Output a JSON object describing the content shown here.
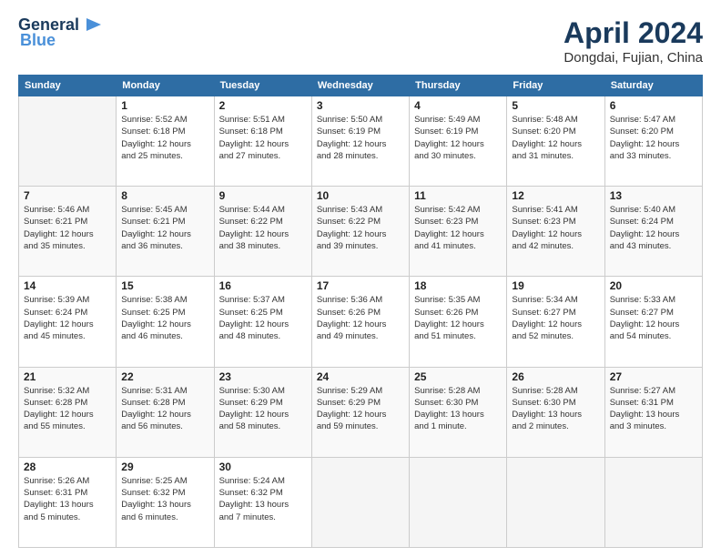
{
  "header": {
    "logo_line1": "General",
    "logo_line2": "Blue",
    "month": "April 2024",
    "location": "Dongdai, Fujian, China"
  },
  "weekdays": [
    "Sunday",
    "Monday",
    "Tuesday",
    "Wednesday",
    "Thursday",
    "Friday",
    "Saturday"
  ],
  "weeks": [
    [
      {
        "day": "",
        "empty": true
      },
      {
        "day": "1",
        "sunrise": "5:52 AM",
        "sunset": "6:18 PM",
        "daylight": "12 hours and 25 minutes."
      },
      {
        "day": "2",
        "sunrise": "5:51 AM",
        "sunset": "6:18 PM",
        "daylight": "12 hours and 27 minutes."
      },
      {
        "day": "3",
        "sunrise": "5:50 AM",
        "sunset": "6:19 PM",
        "daylight": "12 hours and 28 minutes."
      },
      {
        "day": "4",
        "sunrise": "5:49 AM",
        "sunset": "6:19 PM",
        "daylight": "12 hours and 30 minutes."
      },
      {
        "day": "5",
        "sunrise": "5:48 AM",
        "sunset": "6:20 PM",
        "daylight": "12 hours and 31 minutes."
      },
      {
        "day": "6",
        "sunrise": "5:47 AM",
        "sunset": "6:20 PM",
        "daylight": "12 hours and 33 minutes."
      }
    ],
    [
      {
        "day": "7",
        "sunrise": "5:46 AM",
        "sunset": "6:21 PM",
        "daylight": "12 hours and 35 minutes."
      },
      {
        "day": "8",
        "sunrise": "5:45 AM",
        "sunset": "6:21 PM",
        "daylight": "12 hours and 36 minutes."
      },
      {
        "day": "9",
        "sunrise": "5:44 AM",
        "sunset": "6:22 PM",
        "daylight": "12 hours and 38 minutes."
      },
      {
        "day": "10",
        "sunrise": "5:43 AM",
        "sunset": "6:22 PM",
        "daylight": "12 hours and 39 minutes."
      },
      {
        "day": "11",
        "sunrise": "5:42 AM",
        "sunset": "6:23 PM",
        "daylight": "12 hours and 41 minutes."
      },
      {
        "day": "12",
        "sunrise": "5:41 AM",
        "sunset": "6:23 PM",
        "daylight": "12 hours and 42 minutes."
      },
      {
        "day": "13",
        "sunrise": "5:40 AM",
        "sunset": "6:24 PM",
        "daylight": "12 hours and 43 minutes."
      }
    ],
    [
      {
        "day": "14",
        "sunrise": "5:39 AM",
        "sunset": "6:24 PM",
        "daylight": "12 hours and 45 minutes."
      },
      {
        "day": "15",
        "sunrise": "5:38 AM",
        "sunset": "6:25 PM",
        "daylight": "12 hours and 46 minutes."
      },
      {
        "day": "16",
        "sunrise": "5:37 AM",
        "sunset": "6:25 PM",
        "daylight": "12 hours and 48 minutes."
      },
      {
        "day": "17",
        "sunrise": "5:36 AM",
        "sunset": "6:26 PM",
        "daylight": "12 hours and 49 minutes."
      },
      {
        "day": "18",
        "sunrise": "5:35 AM",
        "sunset": "6:26 PM",
        "daylight": "12 hours and 51 minutes."
      },
      {
        "day": "19",
        "sunrise": "5:34 AM",
        "sunset": "6:27 PM",
        "daylight": "12 hours and 52 minutes."
      },
      {
        "day": "20",
        "sunrise": "5:33 AM",
        "sunset": "6:27 PM",
        "daylight": "12 hours and 54 minutes."
      }
    ],
    [
      {
        "day": "21",
        "sunrise": "5:32 AM",
        "sunset": "6:28 PM",
        "daylight": "12 hours and 55 minutes."
      },
      {
        "day": "22",
        "sunrise": "5:31 AM",
        "sunset": "6:28 PM",
        "daylight": "12 hours and 56 minutes."
      },
      {
        "day": "23",
        "sunrise": "5:30 AM",
        "sunset": "6:29 PM",
        "daylight": "12 hours and 58 minutes."
      },
      {
        "day": "24",
        "sunrise": "5:29 AM",
        "sunset": "6:29 PM",
        "daylight": "12 hours and 59 minutes."
      },
      {
        "day": "25",
        "sunrise": "5:28 AM",
        "sunset": "6:30 PM",
        "daylight": "13 hours and 1 minute."
      },
      {
        "day": "26",
        "sunrise": "5:28 AM",
        "sunset": "6:30 PM",
        "daylight": "13 hours and 2 minutes."
      },
      {
        "day": "27",
        "sunrise": "5:27 AM",
        "sunset": "6:31 PM",
        "daylight": "13 hours and 3 minutes."
      }
    ],
    [
      {
        "day": "28",
        "sunrise": "5:26 AM",
        "sunset": "6:31 PM",
        "daylight": "13 hours and 5 minutes."
      },
      {
        "day": "29",
        "sunrise": "5:25 AM",
        "sunset": "6:32 PM",
        "daylight": "13 hours and 6 minutes."
      },
      {
        "day": "30",
        "sunrise": "5:24 AM",
        "sunset": "6:32 PM",
        "daylight": "13 hours and 7 minutes."
      },
      {
        "day": "",
        "empty": true
      },
      {
        "day": "",
        "empty": true
      },
      {
        "day": "",
        "empty": true
      },
      {
        "day": "",
        "empty": true
      }
    ]
  ]
}
